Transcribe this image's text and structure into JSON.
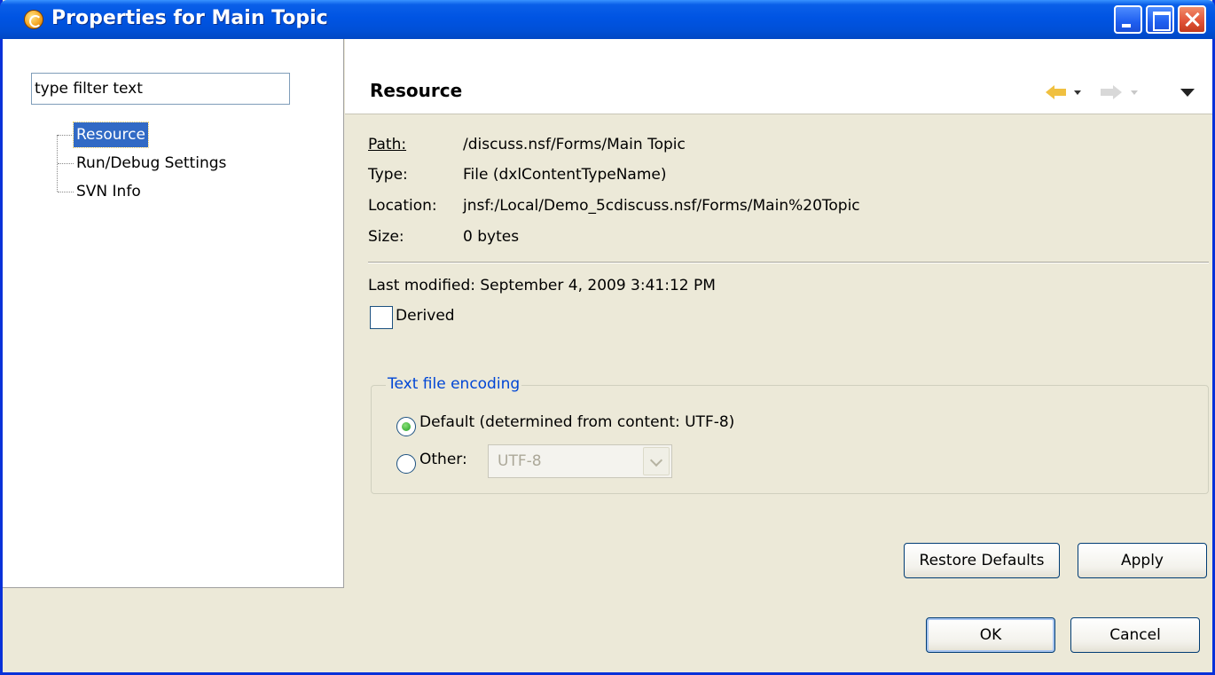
{
  "window": {
    "title": "Properties for Main Topic"
  },
  "filter": {
    "placeholder": "type filter text"
  },
  "tree": {
    "items": [
      {
        "label": "Resource",
        "selected": true
      },
      {
        "label": "Run/Debug Settings",
        "selected": false
      },
      {
        "label": "SVN Info",
        "selected": false
      }
    ]
  },
  "page": {
    "title": "Resource",
    "properties": {
      "path": {
        "label": "Path:",
        "value": "/discuss.nsf/Forms/Main Topic"
      },
      "type": {
        "label": "Type:",
        "value": "File  (dxlContentTypeName)"
      },
      "location": {
        "label": "Location:",
        "value": "jnsf:/Local/Demo_5cdiscuss.nsf/Forms/Main%20Topic"
      },
      "size": {
        "label": "Size:",
        "value": "0  bytes"
      }
    },
    "last_modified_label": "Last modified:",
    "last_modified_value": "September 4, 2009 3:41:12 PM",
    "derived_label": "Derived",
    "derived_checked": false,
    "encoding": {
      "group_label": "Text file encoding",
      "default_label": "Default (determined from content: UTF-8)",
      "other_label": "Other:",
      "selected": "default",
      "other_value": "UTF-8"
    },
    "restore_defaults_label": "Restore Defaults",
    "apply_label": "Apply"
  },
  "footer": {
    "ok_label": "OK",
    "cancel_label": "Cancel"
  },
  "colors": {
    "titlebar": "#0054e3",
    "selection": "#316ac5",
    "group_label": "#0046d5"
  }
}
